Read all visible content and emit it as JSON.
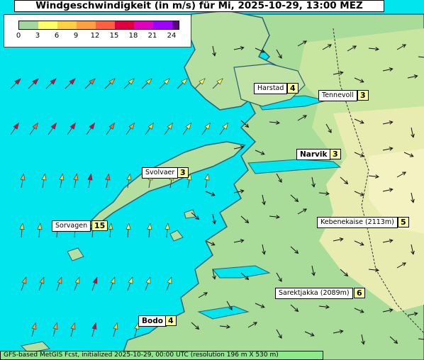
{
  "title": "Windgeschwindigkeit (in m/s) für Mi, 2025-10-29, 13:00 MEZ",
  "legend": {
    "ticks": [
      "0",
      "3",
      "6",
      "9",
      "12",
      "15",
      "18",
      "21",
      "24"
    ],
    "colors": [
      "#a0d8a0",
      "#ffff66",
      "#ffd040",
      "#ffa040",
      "#ff6040",
      "#e00040",
      "#e000c0",
      "#a000ff",
      "#600080"
    ]
  },
  "places": [
    {
      "name": "Harstad",
      "speed": "4",
      "bold": false
    },
    {
      "name": "Tennevoll",
      "speed": "3",
      "bold": false
    },
    {
      "name": "Narvik",
      "speed": "3",
      "bold": true
    },
    {
      "name": "Svolvaer",
      "speed": "3",
      "bold": false
    },
    {
      "name": "Sorvagen",
      "speed": "15",
      "bold": false
    },
    {
      "name": "Kebenekaise (2113m)",
      "speed": "5",
      "bold": false
    },
    {
      "name": "Sarektjakka (2089m)",
      "speed": "6",
      "bold": false
    },
    {
      "name": "Bodo",
      "speed": "4",
      "bold": true
    }
  ],
  "footer": "GFS-based MetGIS Fcst, initialized 2025-10-29, 00:00 UTC  (resolution 196 m X 530 m)",
  "colors": {
    "sea": "#00e5ee",
    "land_low": "#9fd98f",
    "land_mid": "#c8e6a0",
    "land_high": "#f0f0b0",
    "coast": "#2a6070"
  }
}
